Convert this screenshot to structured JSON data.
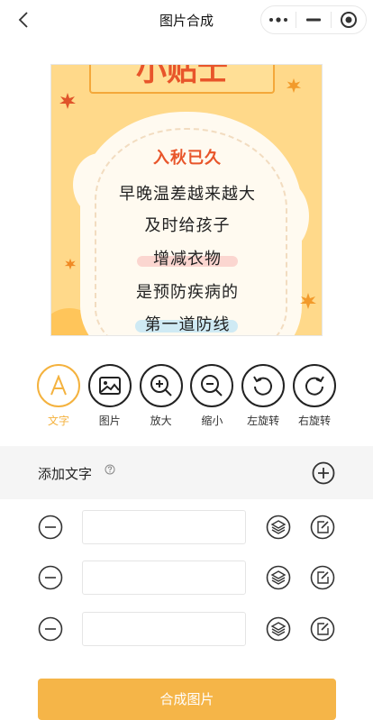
{
  "navbar": {
    "title": "图片合成"
  },
  "poster": {
    "title": "小贴士",
    "lines": [
      "入秋已久",
      "早晚温差越来越大",
      "及时给孩子",
      "增减衣物",
      "是预防疾病的",
      "第一道防线"
    ],
    "colors": {
      "background": "#ffd98a",
      "accent": "#e8552a",
      "cloud": "#fffaf0"
    }
  },
  "tools": [
    {
      "label": "文字",
      "icon": "text-icon",
      "active": true
    },
    {
      "label": "图片",
      "icon": "image-icon",
      "active": false
    },
    {
      "label": "放大",
      "icon": "zoom-in-icon",
      "active": false
    },
    {
      "label": "缩小",
      "icon": "zoom-out-icon",
      "active": false
    },
    {
      "label": "左旋转",
      "icon": "rotate-left-icon",
      "active": false
    },
    {
      "label": "右旋转",
      "icon": "rotate-right-icon",
      "active": false
    }
  ],
  "add_text": {
    "label": "添加文字"
  },
  "text_rows": [
    {
      "value": ""
    },
    {
      "value": ""
    },
    {
      "value": ""
    }
  ],
  "submit": {
    "label": "合成图片"
  },
  "theme": {
    "accent": "#f4b23e",
    "submit_bg": "#f5b548"
  }
}
